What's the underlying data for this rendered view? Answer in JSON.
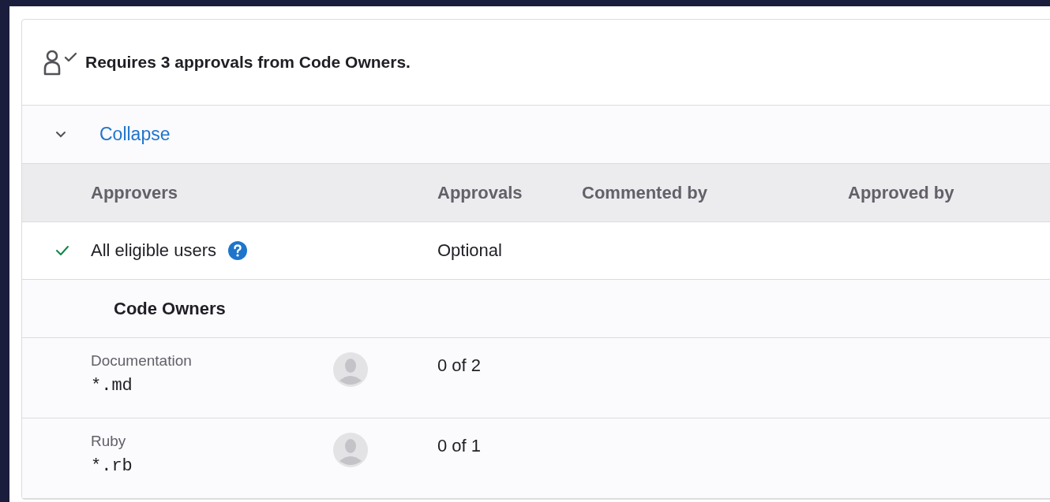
{
  "summary": {
    "text": "Requires 3 approvals from Code Owners."
  },
  "toggle": {
    "label": "Collapse",
    "expanded": true
  },
  "table": {
    "columns": [
      "Approvers",
      "Approvals",
      "Commented by",
      "Approved by"
    ],
    "rows": [
      {
        "kind": "rule",
        "name": "All eligible users",
        "approved": true,
        "approvals": "Optional"
      },
      {
        "kind": "section",
        "name": "Code Owners"
      },
      {
        "kind": "owner",
        "name": "Documentation",
        "pattern": "*.md",
        "approvals": "0 of 2"
      },
      {
        "kind": "owner",
        "name": "Ruby",
        "pattern": "*.rb",
        "approvals": "0 of 1"
      }
    ]
  }
}
